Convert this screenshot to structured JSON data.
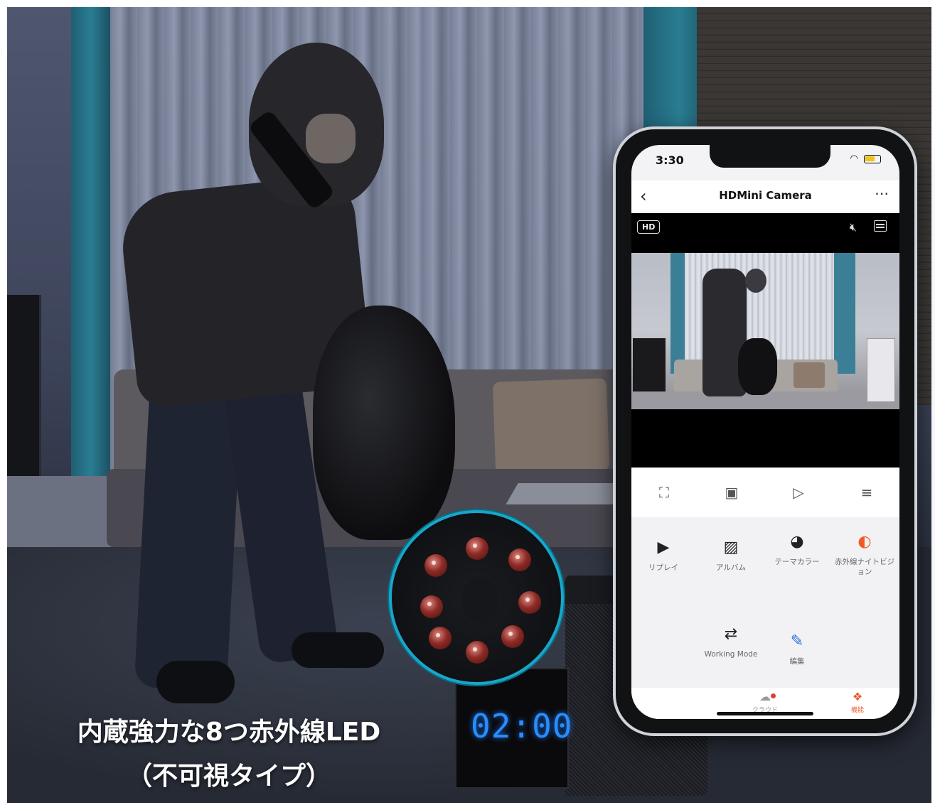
{
  "caption": {
    "line1": "内蔵強力な8つ赤外線LED",
    "line2": "（不可視タイプ）"
  },
  "clock": {
    "display": "02:00",
    "display_color": "#2a8dff"
  },
  "phone": {
    "status": {
      "time": "3:30",
      "wifi_icon": "wifi-icon",
      "battery_icon": "battery-charging-icon"
    },
    "navbar": {
      "back_icon": "chevron-left-icon",
      "title": "HDMini Camera",
      "more_icon": "more-dots-icon"
    },
    "video": {
      "quality_badge": "HD",
      "mute_icon": "speaker-muted-icon",
      "menu_icon": "menu-icon"
    },
    "controls": [
      "fullscreen-icon",
      "screenshot-icon",
      "record-icon",
      "collapse-icon"
    ],
    "features": [
      {
        "label": "リプレイ",
        "icon": "play-circle-icon"
      },
      {
        "label": "アルバム",
        "icon": "album-icon"
      },
      {
        "label": "テーマカラー",
        "icon": "palette-icon"
      },
      {
        "label": "赤外線ナイトビジョン",
        "icon": "night-vision-icon",
        "color": "#f05a28"
      },
      {
        "label": "Working Mode",
        "icon": "working-mode-icon"
      },
      {
        "label": "編集",
        "icon": "edit-icon",
        "color": "#2d6fd8"
      }
    ],
    "tabs": [
      {
        "label": "クラウド",
        "icon": "cloud-icon"
      },
      {
        "label": "機能",
        "icon": "features-icon",
        "color": "#f05a28"
      }
    ]
  }
}
